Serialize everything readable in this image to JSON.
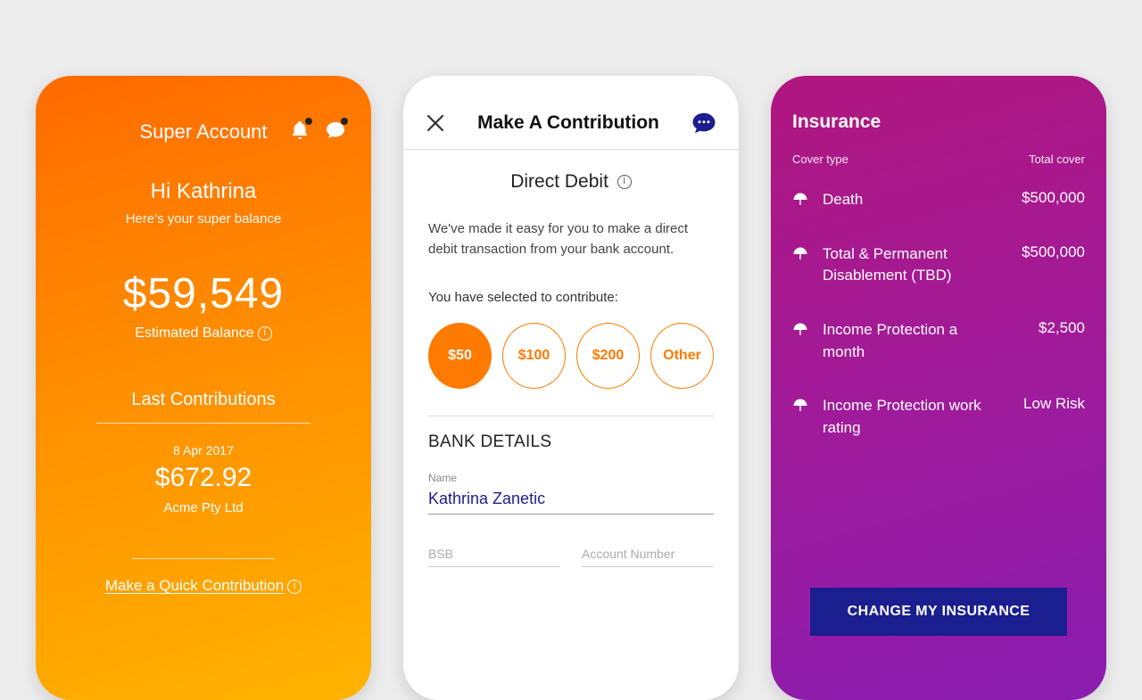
{
  "summary": {
    "title": "Super Account",
    "greeting": "Hi Kathrina",
    "subgreeting": "Here's your super balance",
    "balance": "$59,549",
    "balance_label": "Estimated Balance",
    "last_contributions_heading": "Last Contributions",
    "last_contribution": {
      "date": "8 Apr 2017",
      "amount": "$672.92",
      "payer": "Acme Pty Ltd"
    },
    "quick_link": "Make a Quick Contribution"
  },
  "contribution": {
    "header": "Make A Contribution",
    "method": "Direct Debit",
    "description": "We've made it easy for you to make a direct debit transaction from your bank account.",
    "select_label": "You have selected to contribute:",
    "amounts": [
      "$50",
      "$100",
      "$200",
      "Other"
    ],
    "selected_amount": "$50",
    "bank_heading": "BANK DETAILS",
    "fields": {
      "name_label": "Name",
      "name_value": "Kathrina Zanetic",
      "bsb_placeholder": "BSB",
      "account_placeholder": "Account Number"
    }
  },
  "insurance": {
    "title": "Insurance",
    "columns": {
      "left": "Cover type",
      "right": "Total cover"
    },
    "items": [
      {
        "name": "Death",
        "value": "$500,000"
      },
      {
        "name": "Total & Permanent Disablement (TBD)",
        "value": "$500,000"
      },
      {
        "name": "Income Protection a month",
        "value": "$2,500"
      },
      {
        "name": "Income Protection work rating",
        "value": "Low Risk"
      }
    ],
    "button": "CHANGE MY INSURANCE"
  }
}
